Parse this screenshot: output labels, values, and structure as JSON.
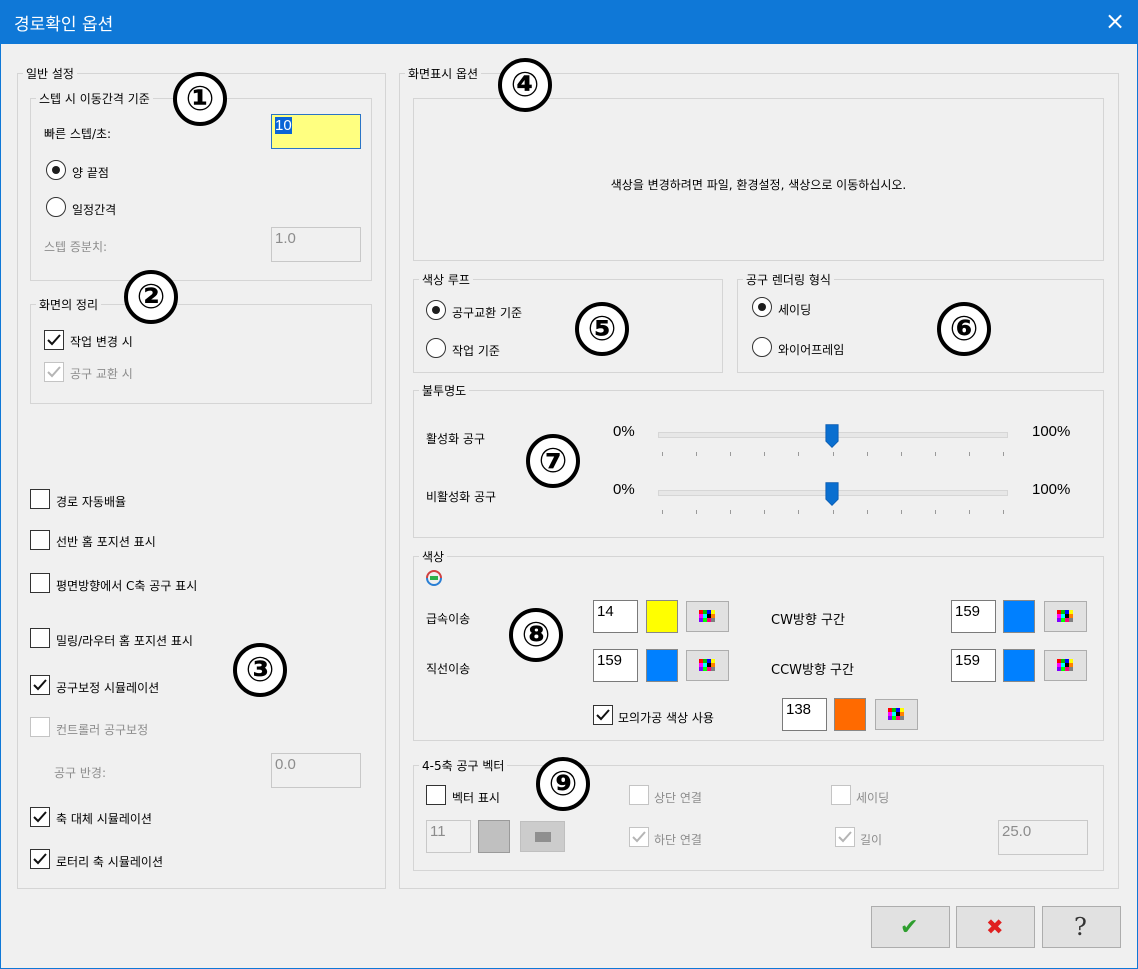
{
  "window": {
    "title": "경로확인 옵션",
    "close_icon": "×"
  },
  "general": {
    "legend": "일반 설정",
    "step": {
      "legend": "스텝 시 이동간격 기준",
      "fast_label": "빠른 스텝/초:",
      "fast_value": "10",
      "radio_both": "양 끝점",
      "radio_interval": "일정간격",
      "increment_label": "스텝 증분치:",
      "increment_value": "1.0"
    },
    "screen": {
      "legend": "화면의 정리",
      "on_op_change": "작업 변경 시",
      "on_tool_change": "공구 교환 시"
    },
    "auto_arrange": "경로 자동배율",
    "lathe_home": "선반 홈 포지션 표시",
    "c_axis_tool": "평면방향에서 C축 공구 표시",
    "mill_home": "밀링/라우터 홈 포지션 표시",
    "tool_comp_sim": "공구보정 시뮬레이션",
    "controller_comp": "컨트롤러 공구보정",
    "tool_radius_label": "공구 반경:",
    "tool_radius_value": "0.0",
    "axis_sub_sim": "축 대체 시뮬레이션",
    "rotary_sim": "로터리 축 시뮬레이션"
  },
  "display": {
    "legend": "화면표시 옵션",
    "color_hint": "색상을 변경하려면 파일, 환경설정, 색상으로 이동하십시오.",
    "loop": {
      "legend": "색상 루프",
      "by_tool_change": "공구교환 기준",
      "by_operation": "작업 기준"
    },
    "render": {
      "legend": "공구 렌더링 형식",
      "shading": "세이딩",
      "wireframe": "와이어프레임"
    },
    "opacity": {
      "legend": "불투명도",
      "active_label": "활성화 공구",
      "inactive_label": "비활성화 공구",
      "min": "0%",
      "max": "100%",
      "active_value": 0.5,
      "inactive_value": 0.5
    },
    "colors": {
      "legend": "색상",
      "rapid_label": "급속이송",
      "rapid_value": "14",
      "rapid_color": "#ffff00",
      "linear_label": "직선이송",
      "linear_value": "159",
      "linear_color": "#0080ff",
      "cw_label": "CW방향 구간",
      "cw_value": "159",
      "cw_color": "#0080ff",
      "ccw_label": "CCW방향 구간",
      "ccw_value": "159",
      "ccw_color": "#0080ff",
      "sim_color_label": "모의가공 색상 사용",
      "sim_value": "138",
      "sim_color": "#ff6a00"
    },
    "vector": {
      "legend": "4-5축 공구 벡터",
      "show_vector": "벡터 표시",
      "top_link": "상단 연결",
      "shading": "세이딩",
      "bottom_link": "하단 연결",
      "length": "길이",
      "color_value": "11",
      "length_value": "25.0",
      "color": "#c0c0c0"
    }
  },
  "badges": [
    "①",
    "②",
    "③",
    "④",
    "⑤",
    "⑥",
    "⑦",
    "⑧",
    "⑨"
  ],
  "buttons": {
    "ok_icon": "✔",
    "cancel_icon": "✖",
    "help_icon": "?"
  }
}
